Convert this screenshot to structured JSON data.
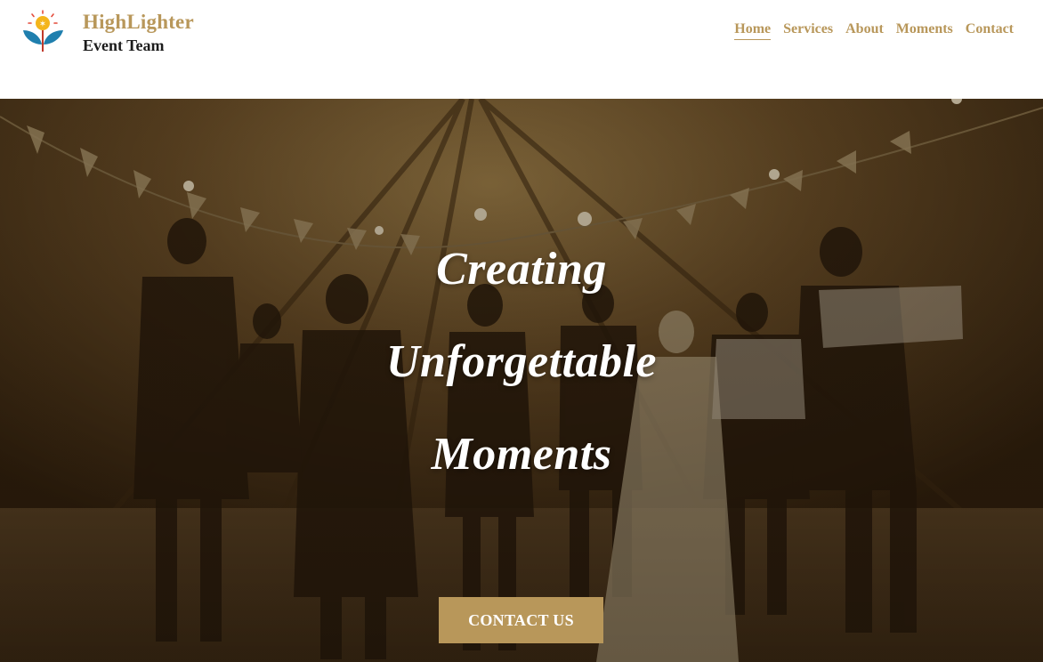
{
  "brand": {
    "name_line1": "HighLighter",
    "name_line2": "Event Team",
    "logo_icon": "lightbulb-leaves-logo",
    "brand_color": "#b8975a"
  },
  "nav": {
    "items": [
      {
        "label": "Home",
        "active": true
      },
      {
        "label": "Services",
        "active": false
      },
      {
        "label": "About",
        "active": false
      },
      {
        "label": "Moments",
        "active": false
      },
      {
        "label": "Contact",
        "active": false
      }
    ]
  },
  "hero": {
    "headline_lines": [
      "Creating",
      "Unforgettable",
      "Moments"
    ],
    "cta_label": "CONTACT US",
    "background_image": "people-dancing-at-wedding-party-in-tent"
  }
}
